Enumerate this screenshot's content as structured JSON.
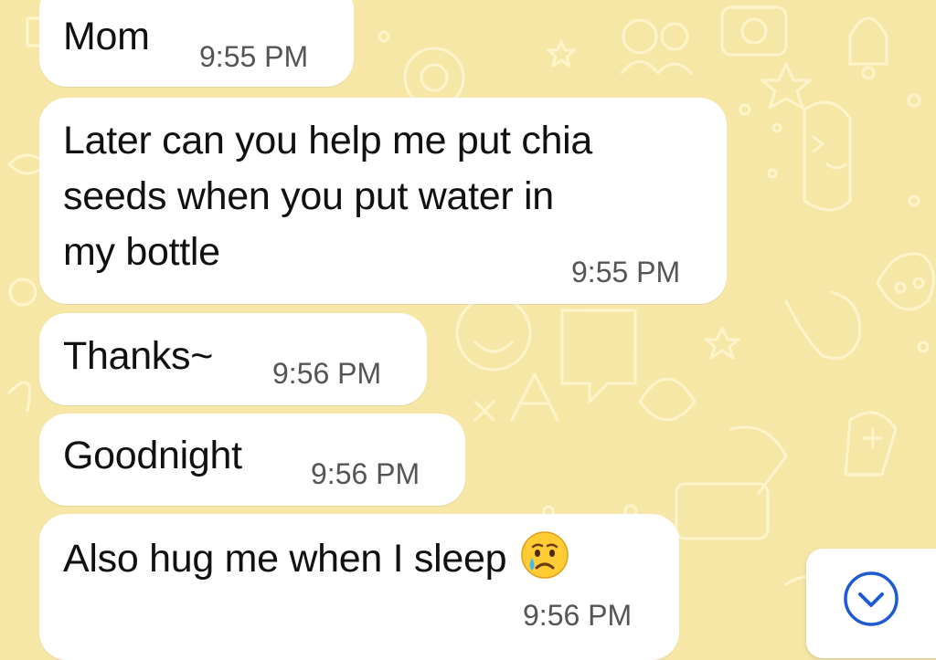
{
  "chat": {
    "messages": [
      {
        "text": "Mom",
        "time": "9:55 PM"
      },
      {
        "lines": [
          "Later can you help me put chia",
          "seeds when you put water in",
          "my bottle"
        ],
        "time": "9:55 PM"
      },
      {
        "text": "Thanks~",
        "time": "9:56 PM"
      },
      {
        "text": "Goodnight",
        "time": "9:56 PM"
      },
      {
        "text": "Also hug me when I sleep",
        "emoji": "crying-face",
        "time": "9:56 PM"
      }
    ]
  },
  "icons": {
    "scroll_down": "chevron-down-circle-icon",
    "emoji": "crying-face-icon"
  },
  "colors": {
    "wallpaper": "#f6e7a7",
    "bubble": "#ffffff",
    "accent": "#1f5ad6",
    "timestamp": "#555555"
  }
}
